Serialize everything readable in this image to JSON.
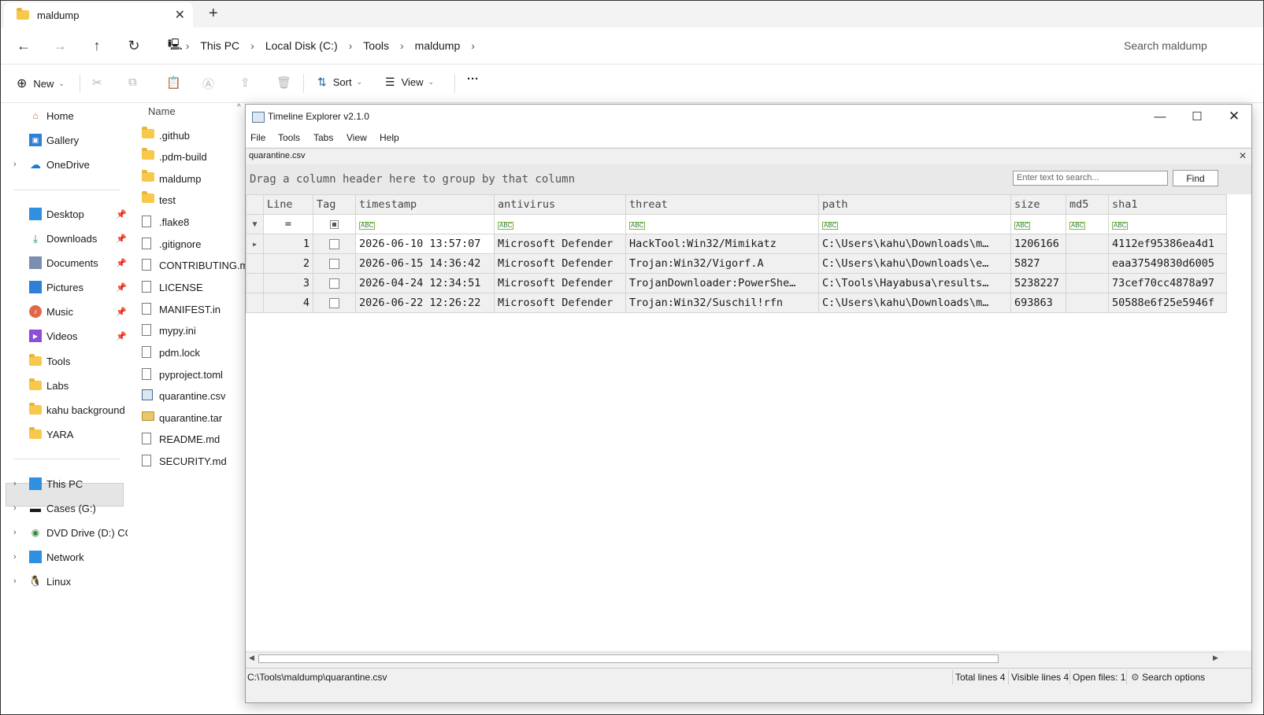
{
  "tab": {
    "title": "maldump"
  },
  "address": {
    "crumbs": [
      "This PC",
      "Local Disk (C:)",
      "Tools",
      "maldump"
    ],
    "search_placeholder": "Search maldump"
  },
  "toolbar": {
    "new_label": "New",
    "sort_label": "Sort",
    "view_label": "View",
    "more_label": "···"
  },
  "sidebar": {
    "top": [
      "Home",
      "Gallery",
      "OneDrive"
    ],
    "pinned": [
      "Desktop",
      "Downloads",
      "Documents",
      "Pictures",
      "Music",
      "Videos"
    ],
    "folders": [
      "Tools",
      "Labs",
      "kahu background",
      "YARA"
    ],
    "drives": [
      "This PC",
      "Cases (G:)",
      "DVD Drive (D:) CCC",
      "Network",
      "Linux"
    ]
  },
  "filelist": {
    "header": "Name",
    "items": [
      ".github",
      ".pdm-build",
      "maldump",
      "test",
      ".flake8",
      ".gitignore",
      "CONTRIBUTING.md",
      "LICENSE",
      "MANIFEST.in",
      "mypy.ini",
      "pdm.lock",
      "pyproject.toml",
      "quarantine.csv",
      "quarantine.tar",
      "README.md",
      "SECURITY.md"
    ]
  },
  "tle": {
    "title": "Timeline Explorer v2.1.0",
    "menu": [
      "File",
      "Tools",
      "Tabs",
      "View",
      "Help"
    ],
    "tab_name": "quarantine.csv",
    "group_msg": "Drag a column header here to group by that column",
    "search_placeholder": "Enter text to search...",
    "find_label": "Find",
    "columns": [
      "Line",
      "Tag",
      "timestamp",
      "antivirus",
      "threat",
      "path",
      "size",
      "md5",
      "sha1"
    ],
    "filter_equals": "=",
    "rows": [
      {
        "line": "1",
        "timestamp": "2026-06-10 13:57:07",
        "antivirus": "Microsoft Defender",
        "threat": "HackTool:Win32/Mimikatz",
        "path": "C:\\Users\\kahu\\Downloads\\m…",
        "size": "1206166",
        "md5": "",
        "sha1": "4112ef95386ea4d1"
      },
      {
        "line": "2",
        "timestamp": "2026-06-15 14:36:42",
        "antivirus": "Microsoft Defender",
        "threat": "Trojan:Win32/Vigorf.A",
        "path": "C:\\Users\\kahu\\Downloads\\e…",
        "size": "5827",
        "md5": "",
        "sha1": "eaa37549830d6005"
      },
      {
        "line": "3",
        "timestamp": "2026-04-24 12:34:51",
        "antivirus": "Microsoft Defender",
        "threat": "TrojanDownloader:PowerShe…",
        "path": "C:\\Tools\\Hayabusa\\results…",
        "size": "5238227",
        "md5": "",
        "sha1": "73cef70cc4878a97"
      },
      {
        "line": "4",
        "timestamp": "2026-06-22 12:26:22",
        "antivirus": "Microsoft Defender",
        "threat": "Trojan:Win32/Suschil!rfn",
        "path": "C:\\Users\\kahu\\Downloads\\m…",
        "size": "693863",
        "md5": "",
        "sha1": "50588e6f25e5946f"
      }
    ],
    "status": {
      "path": "C:\\Tools\\maldump\\quarantine.csv",
      "total": "Total lines 4",
      "visible": "Visible lines 4",
      "open_files": "Open files: 1",
      "search_options": "Search options"
    }
  }
}
